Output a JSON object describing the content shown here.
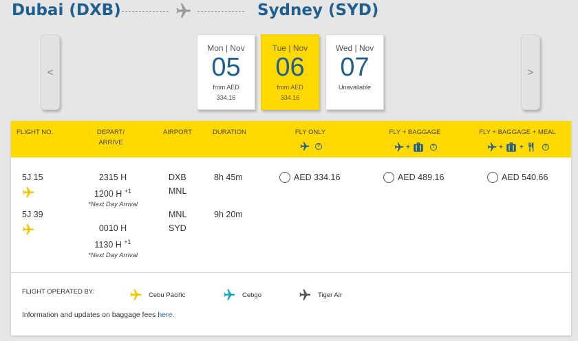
{
  "route": {
    "origin": "Dubai (DXB)",
    "destination": "Sydney (SYD)"
  },
  "nav": {
    "prev_label": "<",
    "next_label": ">"
  },
  "dates": [
    {
      "dow": "Mon | Nov",
      "day": "05",
      "line1": "from AED",
      "line2": "334.16",
      "selected": false
    },
    {
      "dow": "Tue | Nov",
      "day": "06",
      "line1": "from AED",
      "line2": "334.16",
      "selected": true
    },
    {
      "dow": "Wed | Nov",
      "day": "07",
      "line1": "Unavailable",
      "line2": "",
      "selected": false
    }
  ],
  "table": {
    "headers": {
      "flight_no": "FLIGHT NO.",
      "depart_arrive_1": "DEPART/",
      "depart_arrive_2": "ARRIVE",
      "airport": "AIRPORT",
      "duration": "DURATION",
      "fly_only": "FLY ONLY",
      "fly_baggage": "FLY + BAGGAGE",
      "fly_baggage_meal": "FLY + BAGGAGE + MEAL",
      "help_glyph": "?"
    },
    "segments": [
      {
        "flight": "5J 15",
        "depart": "2315 H",
        "arrive": "1200 H",
        "arrive_sup": "+1",
        "note": "*Next Day Arrival",
        "from": "DXB",
        "to": "MNL",
        "duration": "8h 45m"
      },
      {
        "flight": "5J 39",
        "depart": "0010 H",
        "arrive": "1130 H",
        "arrive_sup": "+1",
        "note": "*Next Day Arrival",
        "from": "MNL",
        "to": "SYD",
        "duration": "9h 20m"
      }
    ],
    "fares": {
      "fly_only": "AED 334.16",
      "fly_baggage": "AED 489.16",
      "fly_baggage_meal": "AED 540.66"
    }
  },
  "legend": {
    "label": "FLIGHT OPERATED BY:",
    "operators": [
      "Cebu Pacific",
      "Cebgo",
      "Tiger Air"
    ]
  },
  "info": {
    "text": "Information and updates on baggage fees ",
    "link": "here",
    "suffix": "."
  },
  "colors": {
    "brand_blue": "#1f5f8f",
    "brand_yellow": "#ffd900",
    "cebu_pacific": "#f5c400",
    "cebgo": "#1aa3c8",
    "tiger_air": "#555555"
  }
}
